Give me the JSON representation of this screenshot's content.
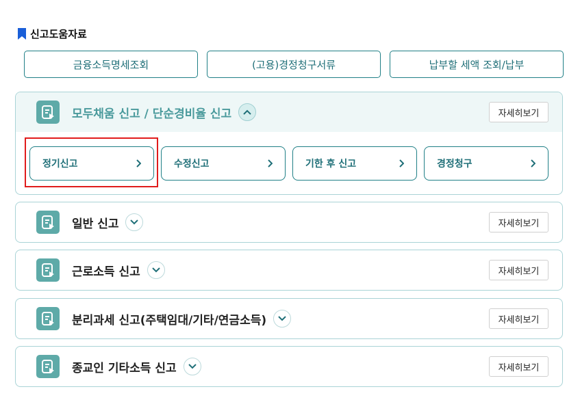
{
  "section": {
    "title": "신고도움자료",
    "icon": "bookmark-icon",
    "icon_color": "#1a5fd8"
  },
  "quick_links": [
    {
      "label": "금융소득명세조회"
    },
    {
      "label": "(고용)경정청구서류"
    },
    {
      "label": "납부할 세액 조회/납부"
    }
  ],
  "panels": [
    {
      "title": "모두채움 신고 / 단순경비율 신고",
      "expanded": true,
      "detail_label": "자세히보기",
      "sub_items": [
        {
          "label": "정기신고",
          "highlighted": true
        },
        {
          "label": "수정신고"
        },
        {
          "label": "기한 후 신고"
        },
        {
          "label": "경정청구"
        }
      ]
    },
    {
      "title": "일반 신고",
      "expanded": false,
      "detail_label": "자세히보기"
    },
    {
      "title": "근로소득 신고",
      "expanded": false,
      "detail_label": "자세히보기"
    },
    {
      "title": "분리과세 신고(주택임대/기타/연금소득)",
      "expanded": false,
      "detail_label": "자세히보기"
    },
    {
      "title": "종교인 기타소득 신고",
      "expanded": false,
      "detail_label": "자세히보기"
    }
  ],
  "colors": {
    "accent": "#1f7f86",
    "panel_border": "#a9d3d6",
    "icon_bg": "#5eaaa8",
    "highlight": "#e01b1b"
  }
}
